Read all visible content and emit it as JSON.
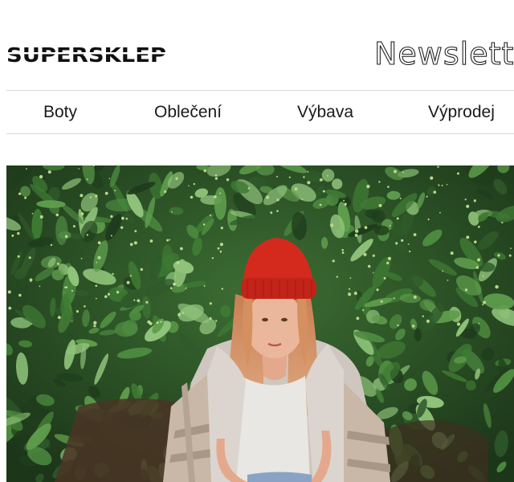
{
  "header": {
    "logo_text": "SUPERSKLEP",
    "newsletter_label": "Newsletter"
  },
  "nav": {
    "items": [
      {
        "label": "Boty"
      },
      {
        "label": "Oblečení"
      },
      {
        "label": "Výbava"
      },
      {
        "label": "Výprodej"
      }
    ]
  },
  "hero": {
    "image": "hero-photo-woman-red-beanie-in-greenery"
  },
  "colors": {
    "beanie": "#d42a1e",
    "foliage_dark": "#1f3d1c",
    "foliage_mid": "#3f7a34",
    "foliage_light": "#8fc27a",
    "hair": "#d4946a",
    "coat": "#d6cfc9",
    "shirt": "#e9e7e3",
    "skin": "#e9b69a"
  }
}
